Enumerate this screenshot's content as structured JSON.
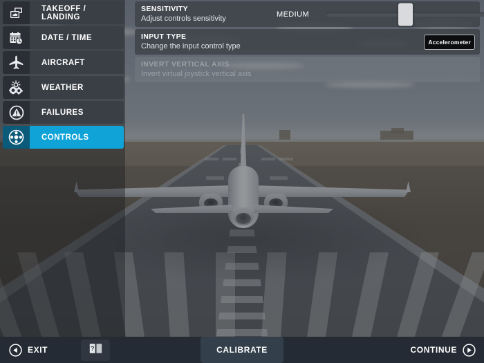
{
  "app": {
    "title": "Flight Simulator Settings",
    "accent_color": "#0fa3d8",
    "accent_dark_color": "#0b5a79",
    "panel_color": "#3f444a",
    "bottom_bar_color": "#252b34"
  },
  "sidebar": {
    "items": [
      {
        "label": "TAKEOFF / LANDING",
        "icon": "takeoff-landing-icon",
        "active": false
      },
      {
        "label": "DATE / TIME",
        "icon": "calendar-clock-icon",
        "active": false
      },
      {
        "label": "AIRCRAFT",
        "icon": "airplane-icon",
        "active": false
      },
      {
        "label": "WEATHER",
        "icon": "weather-sun-cloud-icon",
        "active": false
      },
      {
        "label": "FAILURES",
        "icon": "warning-triangle-icon",
        "active": false
      },
      {
        "label": "CONTROLS",
        "icon": "dpad-icon",
        "active": true
      }
    ]
  },
  "settings": {
    "rows": [
      {
        "title": "SENSITIVITY",
        "subtitle": "Adjust controls sensitivity",
        "control": "slider",
        "value_label": "MEDIUM",
        "slider_percent": 49,
        "disabled": false
      },
      {
        "title": "INPUT TYPE",
        "subtitle": "Change the input control type",
        "control": "button",
        "value_label": "Accelerometer",
        "disabled": false
      },
      {
        "title": "INVERT VERTICAL AXIS",
        "subtitle": "Invert virtual joystick vertical axis",
        "control": "none",
        "value_label": "",
        "disabled": true
      }
    ]
  },
  "bottom_bar": {
    "exit_label": "EXIT",
    "exit_icon": "circle-left-arrow-icon",
    "help_icon": "help-book-icon",
    "calibrate_label": "CALIBRATE",
    "continue_label": "CONTINUE",
    "continue_icon": "circle-right-arrow-icon"
  }
}
